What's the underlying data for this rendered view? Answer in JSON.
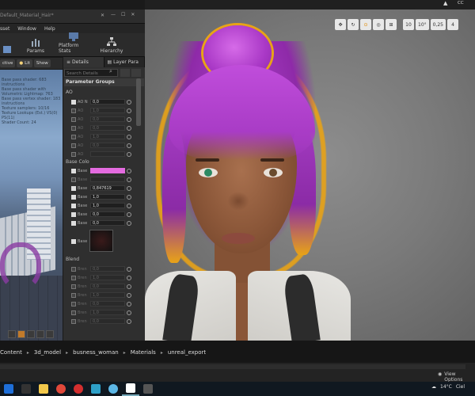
{
  "editor_tab": {
    "title": "Default_Material_Hair*"
  },
  "menu": [
    "sset",
    "Window",
    "Help"
  ],
  "toolbar": {
    "items": [
      {
        "label": "",
        "icon": "asset-icon"
      },
      {
        "label": "Params",
        "icon": "params-icon"
      },
      {
        "label": "Platform Stats",
        "icon": "platform-stats-icon"
      },
      {
        "label": "Hierarchy",
        "icon": "hierarchy-icon"
      }
    ]
  },
  "preview": {
    "mode_buttons": [
      "ctive",
      "Lit",
      "Show"
    ],
    "stats": [
      "Base pass shader: 683 instructions",
      "Base pass shader with Volumetric Lightmap: 763",
      "Base pass vertex shader: 183 instructions",
      "Texture samplers: 10/16",
      "Texture Lookups (Est.) VS(0) PS(11)",
      "Shader Count: 24"
    ]
  },
  "details": {
    "tabs": [
      "Details",
      "Layer Para"
    ],
    "search_placeholder": "Search Details",
    "section_title": "Parameter Groups",
    "groups": {
      "ao": {
        "label": "AO",
        "rows": [
          {
            "label": "AO N",
            "value": "0,0",
            "enabled": true
          },
          {
            "label": "AO",
            "value": "1,0",
            "enabled": false
          },
          {
            "label": "AO",
            "value": "0,0",
            "enabled": false
          },
          {
            "label": "AO",
            "value": "0,0",
            "enabled": false
          },
          {
            "label": "AO",
            "value": "1,0",
            "enabled": false
          },
          {
            "label": "AO",
            "value": "0,0",
            "enabled": false
          },
          {
            "label": "AO",
            "value": "",
            "enabled": false
          }
        ]
      },
      "base": {
        "label": "Base Colo",
        "rows": [
          {
            "label": "Base",
            "value": "",
            "enabled": true,
            "pink": true
          },
          {
            "label": "Base",
            "value": "",
            "enabled": false
          },
          {
            "label": "Base",
            "value": "0,847619",
            "enabled": true
          },
          {
            "label": "Base",
            "value": "1,0",
            "enabled": true
          },
          {
            "label": "Base",
            "value": "1,0",
            "enabled": true
          },
          {
            "label": "Base",
            "value": "0,0",
            "enabled": true
          },
          {
            "label": "Base",
            "value": "0,0",
            "enabled": true
          }
        ],
        "texture_label": "Base"
      },
      "blend": {
        "label": "Blend",
        "rows": [
          {
            "label": "Bren",
            "value": "0,0",
            "enabled": false
          },
          {
            "label": "Bren",
            "value": "1,0",
            "enabled": false
          },
          {
            "label": "Bren",
            "value": "0,0",
            "enabled": false
          },
          {
            "label": "Bren",
            "value": "1,0",
            "enabled": false
          },
          {
            "label": "Bren",
            "value": "0,0",
            "enabled": false
          },
          {
            "label": "Bren",
            "value": "1,0",
            "enabled": false
          },
          {
            "label": "Bren",
            "value": "0,0",
            "enabled": false
          }
        ]
      }
    }
  },
  "viewport": {
    "toolbar": [
      "10",
      "10°",
      "0,25",
      "4"
    ]
  },
  "content_browser": {
    "breadcrumb": [
      "Content",
      "3d_model",
      "busness_woman",
      "Materials",
      "unreal_export"
    ],
    "view_options": "View Options"
  },
  "taskbar": {
    "apps": [
      "windows-icon",
      "search-icon",
      "file-explorer-icon",
      "chrome-icon",
      "opera-icon",
      "maps-icon",
      "c-app-icon",
      "unreal-icon",
      "blank-icon"
    ],
    "weather": "14°C",
    "location_partial": "Ciel"
  },
  "top_corner": {
    "label": "CC"
  },
  "colors": {
    "hair": "#b042cf",
    "selection_outline": "#e8a317",
    "base_color_swatch": "#e46be0"
  }
}
